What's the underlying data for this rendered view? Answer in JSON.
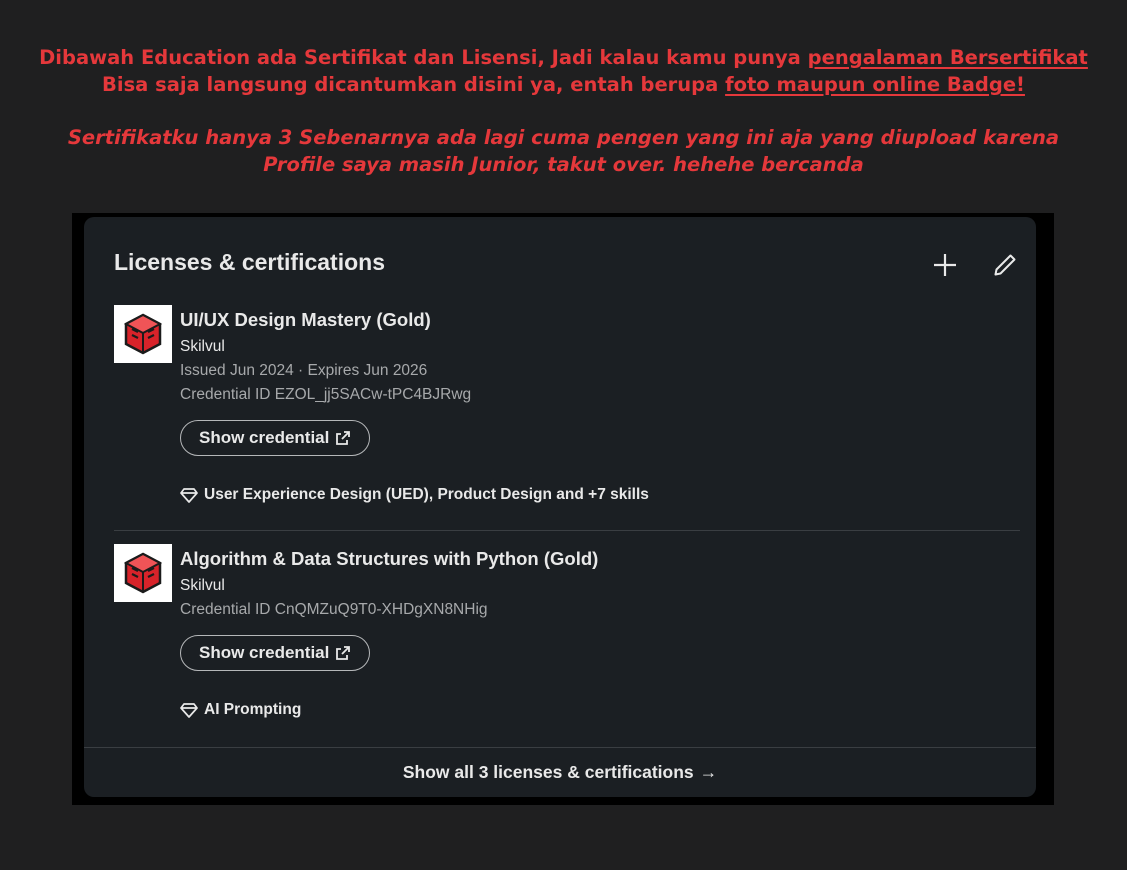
{
  "annotation": {
    "line1_pre": "Dibawah Education ada Sertifikat dan Lisensi, Jadi kalau kamu punya ",
    "line1_link": "pengalaman Bersertifikat",
    "line2_pre": "Bisa saja langsung dicantumkan disini ya, entah berupa ",
    "line2_link": "foto maupun online Badge!",
    "italic_line1": "Sertifikatku hanya 3 Sebenarnya ada lagi cuma pengen yang ini aja yang diupload karena",
    "italic_line2": "Profile saya masih Junior, takut over. hehehe bercanda"
  },
  "section": {
    "title": "Licenses & certifications",
    "add_icon": "plus-icon",
    "edit_icon": "pencil-icon"
  },
  "certifications": [
    {
      "title": "UI/UX Design Mastery (Gold)",
      "issuer": "Skilvul",
      "dates": "Issued Jun 2024 · Expires Jun 2026",
      "credential_id": "Credential ID EZOL_jj5SACw-tPC4BJRwg",
      "button_label": "Show credential",
      "skills": "User Experience Design (UED), Product Design and +7 skills"
    },
    {
      "title": "Algorithm & Data Structures with Python (Gold)",
      "issuer": "Skilvul",
      "credential_id": "Credential ID CnQMZuQ9T0-XHDgXN8NHig",
      "button_label": "Show credential",
      "skills": "AI Prompting"
    }
  ],
  "footer": {
    "label": "Show all 3 licenses & certifications",
    "arrow": "→"
  },
  "colors": {
    "annotation_red": "#e5383b",
    "card_bg": "#1b1f23",
    "page_bg": "#1f1f20",
    "logo_red": "#d8232a"
  }
}
